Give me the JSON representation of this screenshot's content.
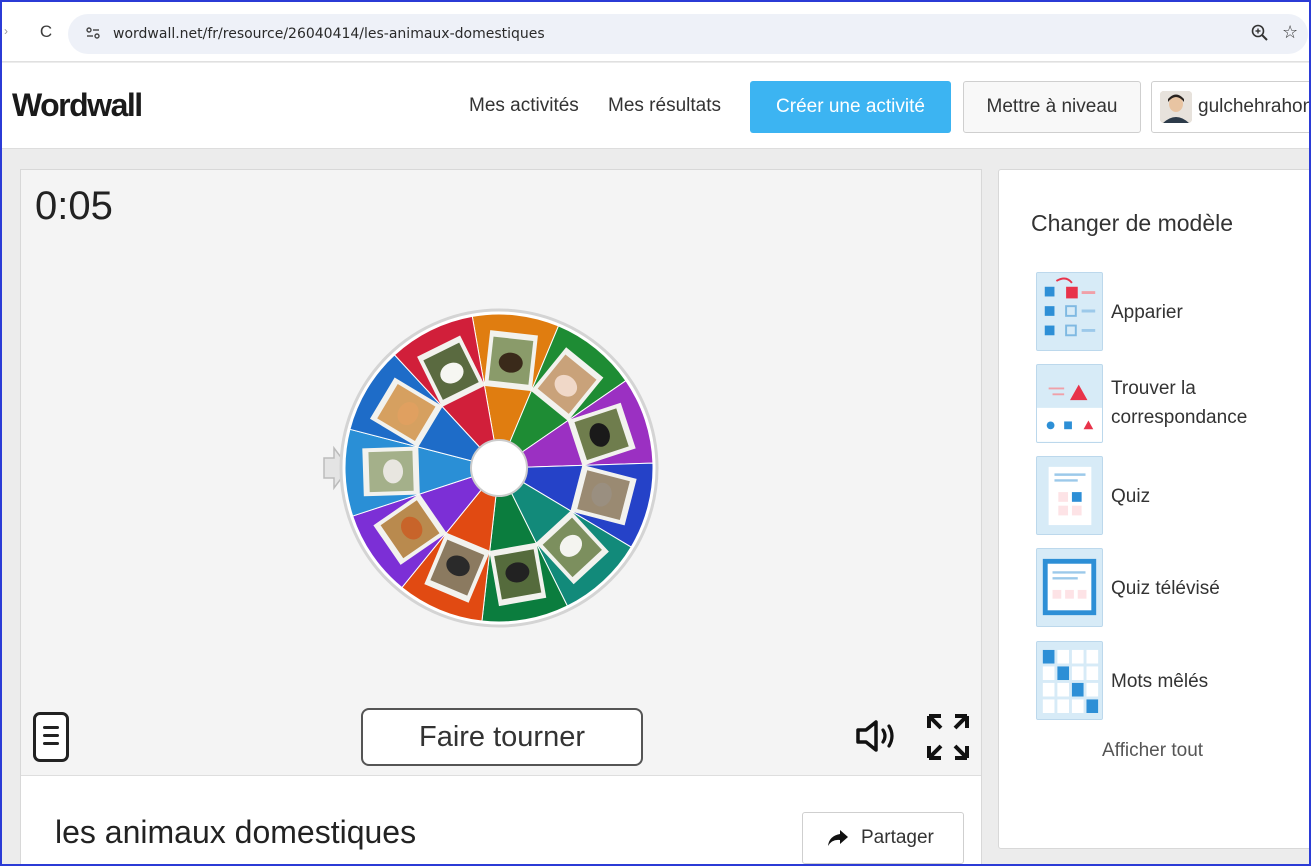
{
  "browser": {
    "url": "wordwall.net/fr/resource/26040414/les-animaux-domestiques",
    "reload_glyph": "C",
    "star_glyph": "☆"
  },
  "header": {
    "logo": "Wordwall",
    "nav": [
      "Mes activités",
      "Mes résultats"
    ],
    "create_label": "Créer une activité",
    "upgrade_label": "Mettre à niveau",
    "username": "gulchehrahon"
  },
  "game": {
    "timer": "0:05",
    "spin_label": "Faire tourner",
    "activity_title": "les animaux domestiques",
    "share_label": "Partager",
    "wheel_segments": [
      {
        "color": "#e07d10",
        "animal": "horse"
      },
      {
        "color": "#1e8c34",
        "animal": "pig"
      },
      {
        "color": "#9b30c2",
        "animal": "rooster"
      },
      {
        "color": "#2542c8",
        "animal": "rabbit"
      },
      {
        "color": "#128a7a",
        "animal": "goat"
      },
      {
        "color": "#0b7d3e",
        "animal": "cow"
      },
      {
        "color": "#e14a12",
        "animal": "cow-2"
      },
      {
        "color": "#7c2fd6",
        "animal": "hen"
      },
      {
        "color": "#2a8fd6",
        "animal": "sheep"
      },
      {
        "color": "#1e6cc8",
        "animal": "cat"
      },
      {
        "color": "#d11f3a",
        "animal": "dog"
      }
    ],
    "colors": {
      "accent": "#3cb4f2"
    }
  },
  "sidebar": {
    "title": "Changer de modèle",
    "templates": [
      {
        "label": "Apparier",
        "icon": "match-up-icon"
      },
      {
        "label": "Trouver la correspondance",
        "icon": "find-match-icon"
      },
      {
        "label": "Quiz",
        "icon": "quiz-icon"
      },
      {
        "label": "Quiz télévisé",
        "icon": "gameshow-quiz-icon"
      },
      {
        "label": "Mots mêlés",
        "icon": "wordsearch-icon"
      }
    ],
    "show_all": "Afficher tout"
  }
}
